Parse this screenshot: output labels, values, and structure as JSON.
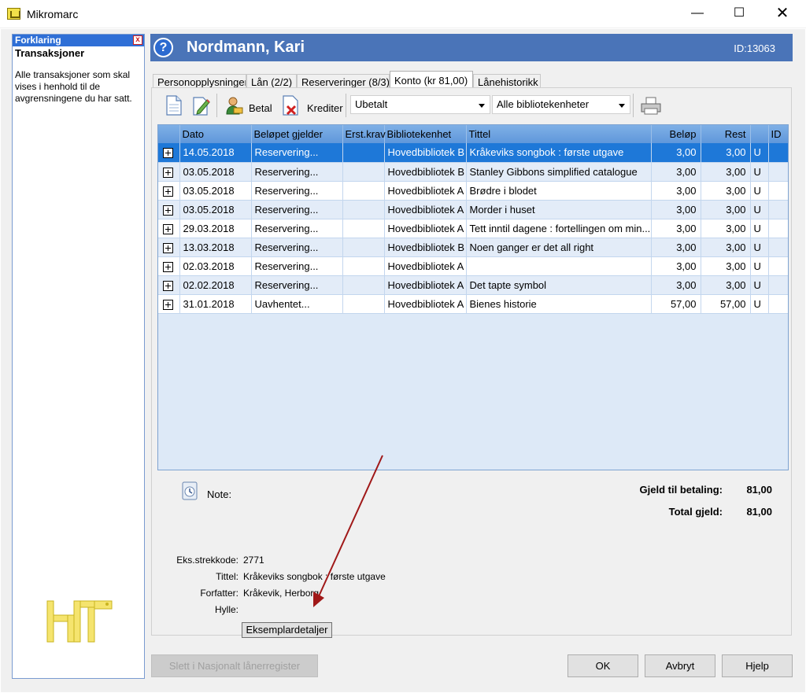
{
  "window": {
    "title": "Mikromarc",
    "minimize": "—",
    "maximize": "☐",
    "close": "✕"
  },
  "explain": {
    "header": "Forklaring",
    "close": "x",
    "title": "Transaksjoner",
    "body": "Alle transaksjoner som skal vises i henhold til de avgrensningene du har satt."
  },
  "patron": {
    "name": "Nordmann, Kari",
    "id": "ID:13063",
    "help": "?"
  },
  "tabs": [
    {
      "label": "Personopplysninger"
    },
    {
      "label": "Lån (2/2)"
    },
    {
      "label": "Reserveringer (8/3)"
    },
    {
      "label": "Konto (kr 81,00)"
    },
    {
      "label": "Lånehistorikk"
    }
  ],
  "toolbar": {
    "pay": "Betal",
    "credit": "Krediter",
    "status_filter": "Ubetalt",
    "unit_filter": "Alle bibliotekenheter"
  },
  "grid": {
    "columns": [
      "Dato",
      "Beløpet gjelder",
      "Erst.krav",
      "Bibliotekenhet",
      "Tittel",
      "Beløp",
      "Rest",
      "",
      "ID"
    ],
    "rows": [
      [
        "14.05.2018",
        "Reservering...",
        "",
        "Hovedbibliotek B",
        "Kråkeviks songbok : første utgave",
        "3,00",
        "3,00",
        "U",
        ""
      ],
      [
        "03.05.2018",
        "Reservering...",
        "",
        "Hovedbibliotek B",
        "Stanley Gibbons simplified catalogue",
        "3,00",
        "3,00",
        "U",
        ""
      ],
      [
        "03.05.2018",
        "Reservering...",
        "",
        "Hovedbibliotek A",
        "Brødre i blodet",
        "3,00",
        "3,00",
        "U",
        ""
      ],
      [
        "03.05.2018",
        "Reservering...",
        "",
        "Hovedbibliotek A",
        "Morder i huset",
        "3,00",
        "3,00",
        "U",
        ""
      ],
      [
        "29.03.2018",
        "Reservering...",
        "",
        "Hovedbibliotek A",
        "Tett inntil dagene : fortellingen om min...",
        "3,00",
        "3,00",
        "U",
        ""
      ],
      [
        "13.03.2018",
        "Reservering...",
        "",
        "Hovedbibliotek B",
        "Noen ganger er det all right",
        "3,00",
        "3,00",
        "U",
        ""
      ],
      [
        "02.03.2018",
        "Reservering...",
        "",
        "Hovedbibliotek A",
        "",
        "3,00",
        "3,00",
        "U",
        ""
      ],
      [
        "02.02.2018",
        "Reservering...",
        "",
        "Hovedbibliotek A",
        "Det tapte symbol",
        "3,00",
        "3,00",
        "U",
        ""
      ],
      [
        "31.01.2018",
        "Uavhentet...",
        "",
        "Hovedbibliotek A",
        "Bienes historie",
        "57,00",
        "57,00",
        "U",
        ""
      ]
    ]
  },
  "note": {
    "label": "Note:"
  },
  "totals": {
    "to_pay_label": "Gjeld til betaling:",
    "to_pay_value": "81,00",
    "total_label": "Total gjeld:",
    "total_value": "81,00"
  },
  "details": {
    "barcode_label": "Eks.strekkode:",
    "barcode_value": "2771",
    "title_label": "Tittel:",
    "title_value": "Kråkeviks songbok : første utgave",
    "author_label": "Forfatter:",
    "author_value": "Kråkevik, Herborg",
    "shelf_label": "Hylle:",
    "shelf_value": "",
    "button": "Eksemplardetaljer"
  },
  "buttons": {
    "delete_national": "Slett i Nasjonalt lånerregister",
    "ok": "OK",
    "cancel": "Avbryt",
    "help": "Hjelp"
  },
  "colors": {
    "header": "#4a74b8",
    "selection": "#1e78d8",
    "arrow": "#a01818"
  }
}
